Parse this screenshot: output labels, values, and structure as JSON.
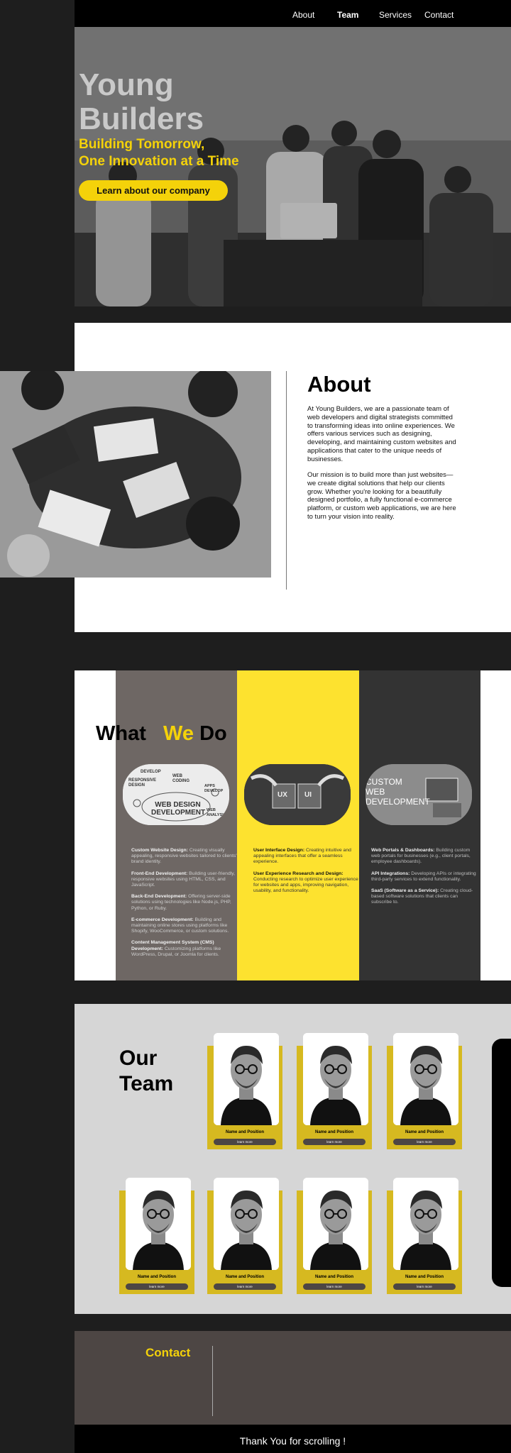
{
  "nav": {
    "items": [
      {
        "label": "About"
      },
      {
        "label": "Team"
      },
      {
        "label": "Services"
      },
      {
        "label": "Contact"
      }
    ],
    "active": "Team"
  },
  "hero": {
    "title_line1": "Young",
    "title_line2": "Builders",
    "tagline_line1": "Building Tomorrow,",
    "tagline_line2": "One Innovation at a Time",
    "cta_label": "Learn about our company"
  },
  "about": {
    "title": "About",
    "paragraph1": "At Young Builders, we are a passionate team of web developers and digital strategists committed to transforming ideas into online experiences.  We offers various services such as designing, developing, and maintaining custom websites and applications that cater to the unique needs of businesses.",
    "paragraph2": "Our mission is to build more than just websites—we create digital solutions that help our clients grow. Whether you're looking for a beautifully designed portfolio, a fully functional e-commerce platform, or custom web applications, we are here to turn your vision into reality."
  },
  "what_we_do": {
    "title_part1": "What",
    "title_part2": "We",
    "title_part3": "Do",
    "badges": {
      "web_design": {
        "main": "WEB DESIGN DEVELOPMENT",
        "tags": [
          "DEVELOP",
          "RESPONSIVE DESIGN",
          "WEB CODING",
          "APPS DEVELOP",
          "WEB ANALYSIS"
        ]
      },
      "ux_ui": {
        "left": "UX",
        "right": "UI"
      },
      "custom_web": {
        "line1": "CUSTOM",
        "line2": "WEB",
        "line3": "DEVELOPMENT"
      }
    },
    "columns": [
      {
        "items": [
          {
            "title": "Custom Website Design:",
            "text": " Creating visually appealing, responsive websites tailored to clients' brand identity."
          },
          {
            "title": "Front-End Development:",
            "text": " Building user-friendly, responsive websites using HTML, CSS, and JavaScript."
          },
          {
            "title": "Back-End Development:",
            "text": " Offering server-side solutions using technologies like Node.js, PHP, Python, or Ruby."
          },
          {
            "title": "E-commerce Development:",
            "text": " Building and maintaining online stores using platforms like Shopify, WooCommerce, or custom solutions."
          },
          {
            "title": "Content Management System (CMS) Development:",
            "text": " Customizing platforms like WordPress, Drupal, or Joomla for clients."
          }
        ]
      },
      {
        "items": [
          {
            "title": "User Interface Design:",
            "text": " Creating intuitive and appealing interfaces that offer a seamless experience."
          },
          {
            "title": "User Experience Research and Design:",
            "text": " Conducting research to optimize user experience for websites and apps, improving navigation, usability, and functionality."
          }
        ]
      },
      {
        "items": [
          {
            "title": "Web Portals & Dashboards:",
            "text": " Building custom web portals for businesses (e.g., client portals, employee dashboards)."
          },
          {
            "title": "API Integrations:",
            "text": " Developing APIs or integrating third-party services to extend functionality."
          },
          {
            "title": "SaaS (Software as a Service):",
            "text": " Creating cloud-based software solutions that clients can subscribe to."
          }
        ]
      }
    ]
  },
  "team": {
    "title_line1": "Our",
    "title_line2": "Team",
    "members": [
      {
        "name": "Name and Position",
        "button": "learn more"
      },
      {
        "name": "Name and Position",
        "button": "learn more"
      },
      {
        "name": "Name and Position",
        "button": "learn more"
      },
      {
        "name": "Name and Position",
        "button": "learn more"
      },
      {
        "name": "Name and Position",
        "button": "learn more"
      },
      {
        "name": "Name and Position",
        "button": "learn more"
      },
      {
        "name": "Name and Position",
        "button": "learn more"
      }
    ]
  },
  "contact": {
    "title": "Contact"
  },
  "footer": {
    "text": "Thank You for scrolling !"
  },
  "colors": {
    "accent": "#f4d20a",
    "dark": "#1e1e1e",
    "brown": "#4d4644",
    "service_yellow": "#fde22f"
  }
}
